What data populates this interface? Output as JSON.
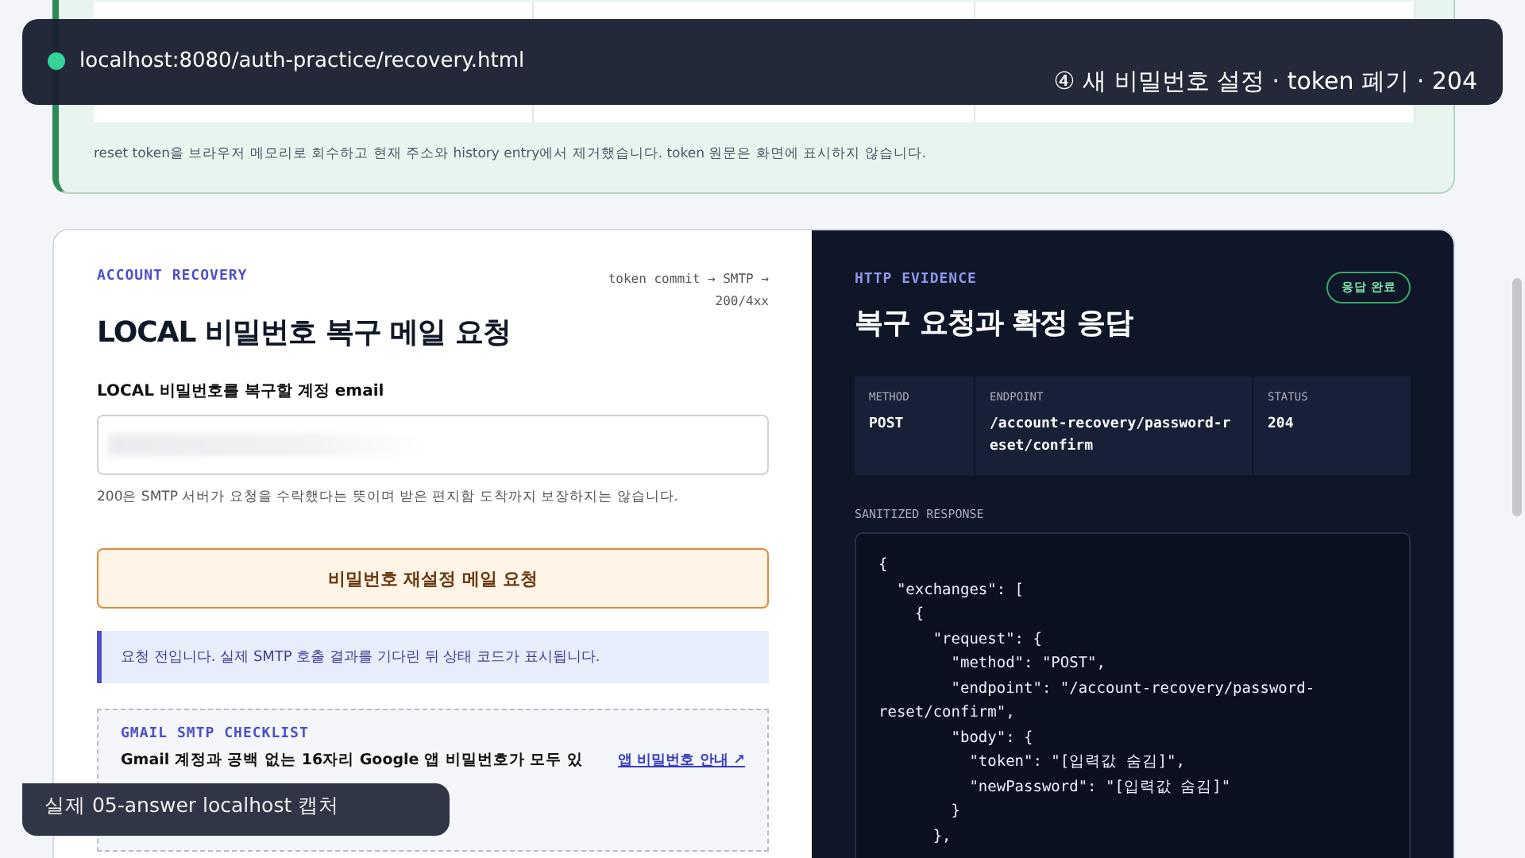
{
  "browser_overlay": {
    "url": "localhost:8080/auth-practice/recovery.html",
    "step_caption": "④ 새 비밀번호 설정 · token 폐기 · 204"
  },
  "completed_card": {
    "note": "reset token을 브라우저 메모리로 회수하고 현재 주소와 history entry에서 제거했습니다. token 원문은 화면에 표시하지 않습니다."
  },
  "request_panel": {
    "eyebrow": "ACCOUNT RECOVERY",
    "flow": "token commit → SMTP → 200/4xx",
    "title": "LOCAL 비밀번호 복구 메일 요청",
    "email_label": "LOCAL 비밀번호를 복구할 계정 email",
    "email_hint": "200은 SMTP 서버가 요청을 수락했다는 뜻이며 받은 편지함 도착까지 보장하지는 않습니다.",
    "submit_button": "비밀번호 재설정 메일 요청",
    "info": "요청 전입니다. 실제 SMTP 호출 결과를 기다린 뒤 상태 코드가 표시됩니다.",
    "checklist": {
      "eyebrow": "GMAIL SMTP CHECKLIST",
      "text": "Gmail 계정과 공백 없는 16자리 Google 앱 비밀번호가 모두 있",
      "link": "앱 비밀번호 안내 ↗"
    }
  },
  "evidence_panel": {
    "eyebrow": "HTTP EVIDENCE",
    "badge": "응답 완료",
    "title": "복구 요청과 확정 응답",
    "fields": [
      {
        "label": "METHOD",
        "value": "POST"
      },
      {
        "label": "ENDPOINT",
        "value": "/account-recovery/password-reset/confirm"
      },
      {
        "label": "STATUS",
        "value": "204"
      }
    ],
    "response_label": "SANITIZED RESPONSE",
    "response_lines": [
      "{",
      "  \"exchanges\": [",
      "    {",
      "      \"request\": {",
      "        \"method\": \"POST\",",
      "        \"endpoint\": \"/account-recovery/password-",
      "reset/confirm\",",
      "        \"body\": {",
      "          \"token\": \"[입력값 숨김]\",",
      "          \"newPassword\": \"[입력값 숨김]\"",
      "        }",
      "      },"
    ]
  },
  "capture_caption": "실제 05-answer localhost 캡처"
}
